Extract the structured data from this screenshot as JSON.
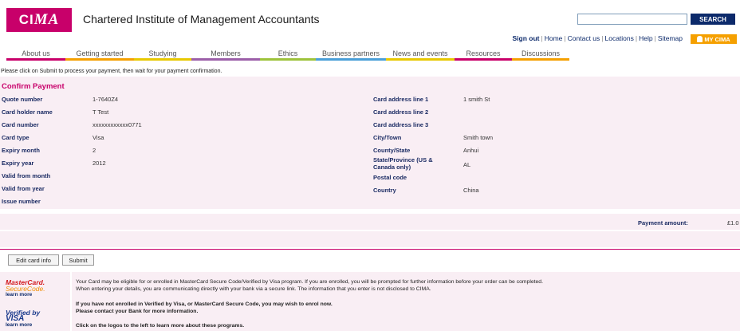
{
  "header": {
    "logo_text": "CIMA",
    "site_title": "Chartered Institute of Management Accountants",
    "search_placeholder": "",
    "search_label": "SEARCH",
    "util_links": {
      "sign_out": "Sign out",
      "home": "Home",
      "contact": "Contact us",
      "locations": "Locations",
      "help": "Help",
      "sitemap": "Sitemap"
    },
    "my_cima": "MY CIMA"
  },
  "nav": [
    {
      "label": "About us",
      "color": "#c8006a"
    },
    {
      "label": "Getting started",
      "color": "#f5a000"
    },
    {
      "label": "Studying",
      "color": "#e8c800"
    },
    {
      "label": "Members",
      "color": "#9b5fa8"
    },
    {
      "label": "Ethics",
      "color": "#9dc23b"
    },
    {
      "label": "Business partners",
      "color": "#4a9fd8"
    },
    {
      "label": "News and events",
      "color": "#e8c800"
    },
    {
      "label": "Resources",
      "color": "#c8006a"
    },
    {
      "label": "Discussions",
      "color": "#f5a000"
    }
  ],
  "instruction": "Please click on Submit to process your payment, then wait for your payment confirmation.",
  "payment": {
    "title": "Confirm Payment",
    "left": [
      {
        "label": "Quote number",
        "value": "1-7640Z4"
      },
      {
        "label": "Card holder name",
        "value": "T Test"
      },
      {
        "label": "Card number",
        "value": "xxxxxxxxxxxx0771"
      },
      {
        "label": "Card type",
        "value": "Visa"
      },
      {
        "label": "Expiry month",
        "value": "2"
      },
      {
        "label": "Expiry year",
        "value": "2012"
      },
      {
        "label": "Valid from month",
        "value": ""
      },
      {
        "label": "Valid from year",
        "value": ""
      },
      {
        "label": "Issue number",
        "value": ""
      }
    ],
    "right": [
      {
        "label": "Card address line 1",
        "value": "1 smith St"
      },
      {
        "label": "Card address line 2",
        "value": ""
      },
      {
        "label": "Card address line 3",
        "value": ""
      },
      {
        "label": "City/Town",
        "value": "Smith town"
      },
      {
        "label": "County/State",
        "value": "Anhui"
      },
      {
        "label": "State/Province (US & Canada only)",
        "value": "AL"
      },
      {
        "label": "Postal code",
        "value": ""
      },
      {
        "label": "Country",
        "value": "China"
      }
    ],
    "amount_label": "Payment amount:",
    "amount_value": "£1.0"
  },
  "buttons": {
    "edit": "Edit card info",
    "submit": "Submit"
  },
  "secure": {
    "mc_line1": "MasterCard.",
    "mc_line2": "SecureCode.",
    "mc_learn": "learn more",
    "visa_line1": "Verified by",
    "visa_line2": "VISA",
    "visa_learn": "learn more",
    "text1": "Your Card may be eligible for or enrolled in MasterCard Secure Code/Verified by Visa program. If you are enrolled, you will be prompted for further information before your order can be completed.",
    "text2": "When entering your details, you are communicating directly with your bank via a secure link. The information that you enter is not disclosed to CIMA.",
    "text3": "If you have not enrolled in Verified by Visa, or MasterCard Secure Code, you may wish to enrol now.",
    "text4": "Please contact your Bank for more information.",
    "text5": "Click on the logos to the left to learn more about these programs."
  }
}
